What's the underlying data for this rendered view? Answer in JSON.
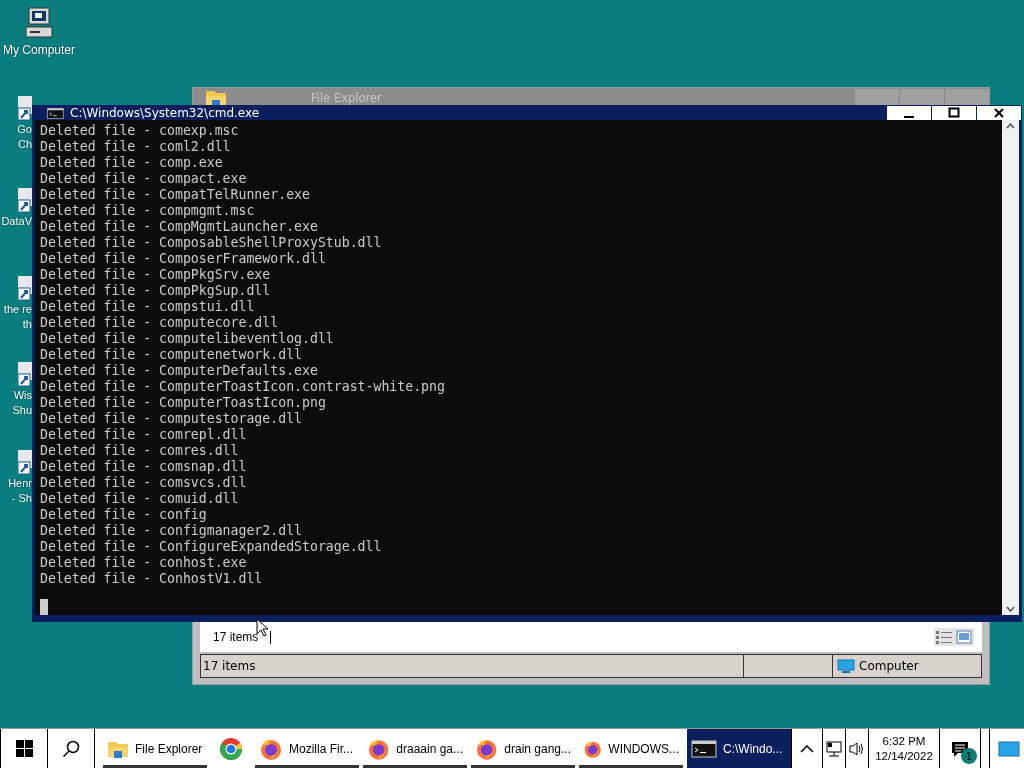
{
  "desktop_icons": [
    {
      "kind": "computer",
      "lines": [
        "My Computer"
      ]
    },
    {
      "kind": "shortcut",
      "lines": [
        "Go",
        "Ch"
      ]
    },
    {
      "kind": "shortcut",
      "lines": [
        "DataV"
      ]
    },
    {
      "kind": "shortcut",
      "lines": [
        "the re",
        "th"
      ]
    },
    {
      "kind": "shortcut",
      "lines": [
        "Wis",
        "Shu"
      ]
    },
    {
      "kind": "shortcut",
      "lines": [
        "Henr",
        "- Sh"
      ]
    }
  ],
  "file_explorer": {
    "title": "File Explorer",
    "content_status": "17 items",
    "status_bar": {
      "items": "17 items",
      "location": "Computer"
    }
  },
  "console": {
    "title": "C:\\Windows\\System32\\cmd.exe",
    "lines": [
      "Deleted file - comexp.msc",
      "Deleted file - coml2.dll",
      "Deleted file - comp.exe",
      "Deleted file - compact.exe",
      "Deleted file - CompatTelRunner.exe",
      "Deleted file - compmgmt.msc",
      "Deleted file - CompMgmtLauncher.exe",
      "Deleted file - ComposableShellProxyStub.dll",
      "Deleted file - ComposerFramework.dll",
      "Deleted file - CompPkgSrv.exe",
      "Deleted file - CompPkgSup.dll",
      "Deleted file - compstui.dll",
      "Deleted file - computecore.dll",
      "Deleted file - computelibeventlog.dll",
      "Deleted file - computenetwork.dll",
      "Deleted file - ComputerDefaults.exe",
      "Deleted file - ComputerToastIcon.contrast-white.png",
      "Deleted file - ComputerToastIcon.png",
      "Deleted file - computestorage.dll",
      "Deleted file - comrepl.dll",
      "Deleted file - comres.dll",
      "Deleted file - comsnap.dll",
      "Deleted file - comsvcs.dll",
      "Deleted file - comuid.dll",
      "Deleted file - config",
      "Deleted file - configmanager2.dll",
      "Deleted file - ConfigureExpandedStorage.dll",
      "Deleted file - conhost.exe",
      "Deleted file - ConhostV1.dll"
    ]
  },
  "taskbar": {
    "items": [
      {
        "kind": "folder",
        "label": "File Explorer",
        "running": true,
        "selected": false
      },
      {
        "kind": "chrome",
        "running": false,
        "selected": false
      },
      {
        "kind": "firefox",
        "label": "Mozilla Fir...",
        "running": true,
        "selected": false
      },
      {
        "kind": "firefox",
        "label": "draaain ga...",
        "running": true,
        "selected": false
      },
      {
        "kind": "firefox",
        "label": "drain gang...",
        "running": true,
        "selected": false
      },
      {
        "kind": "firefox",
        "label": "WINDOWS...",
        "running": true,
        "selected": false
      },
      {
        "kind": "console",
        "label": "C:\\Windo...",
        "running": true,
        "selected": true
      }
    ],
    "time": "6:32 PM",
    "date": "12/14/2022",
    "notification_count": "1"
  }
}
